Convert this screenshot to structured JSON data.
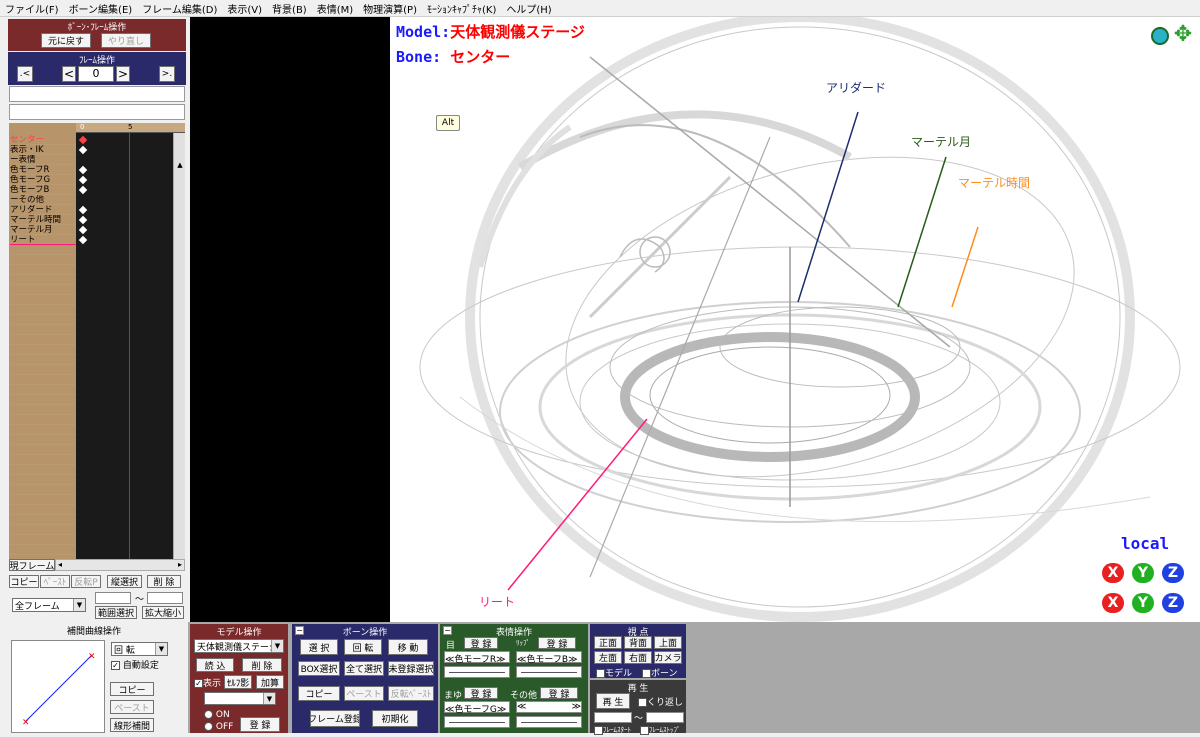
{
  "menu": [
    "ファイル(F)",
    "ボーン編集(E)",
    "フレーム編集(D)",
    "表示(V)",
    "背景(B)",
    "表情(M)",
    "物理演算(P)",
    "ﾓｰｼｮﾝｷｬﾌﾟﾁｬ(K)",
    "ヘルプ(H)"
  ],
  "bone_frame_op": {
    "title": "ﾎﾞｰﾝ･ﾌﾚｰﾑ操作",
    "undo": "元に戻す",
    "redo": "やり直し"
  },
  "frame_op": {
    "title": "ﾌﾚｰﾑ操作",
    "first": ".<",
    "prev": "<",
    "frame": "0",
    "next": ">",
    "last": ">.",
    "first_sym": "|<",
    "last_sym": ">|"
  },
  "timeline": {
    "ruler_0": "0",
    "ruler_5": "5",
    "tracks": [
      "センター",
      "表示・IK",
      "ー表情",
      "色モーフR",
      "色モーフG",
      "色モーフB",
      "ーその他",
      "アリダード",
      "マーテル時間",
      "マーテル月",
      "リート"
    ],
    "current_frame": "現フレーム"
  },
  "frame_edit": {
    "copy": "コピー",
    "paste": "ﾍﾟｰｽﾄ",
    "invert_paste": "反転P",
    "vertical_select": "縦選択",
    "delete": "削 除",
    "range_select_label": "全フレーム",
    "tilde": "～",
    "range_select": "範囲選択",
    "expand_shrink": "拡大縮小"
  },
  "viewport": {
    "model_label": "Model:",
    "model_name": "天体観測儀ステージ",
    "bone_label": "Bone:",
    "bone_name": "センター",
    "alt_badge": "Alt",
    "annotations": {
      "alidade": "アリダード",
      "mater_moon": "マーテル月",
      "mater_time": "マーテル時間",
      "rete": "リート"
    },
    "local": "local",
    "axes_top": [
      "X",
      "Y",
      "Z"
    ],
    "axes_bottom": [
      "X",
      "Y",
      "Z"
    ]
  },
  "interp": {
    "title": "補間曲線操作",
    "mode": "回 転",
    "auto_set": "自動設定",
    "copy": "コピー",
    "paste": "ペースト",
    "linear": "線形補間"
  },
  "model_op": {
    "title": "モデル操作",
    "model_select": "天体観測儀ステージ",
    "load": "読 込",
    "delete": "削 除",
    "display": "表示",
    "self_shadow": "ｾﾙﾌ影",
    "add": "加算",
    "on": "ON",
    "off": "OFF",
    "register": "登 録"
  },
  "bone_op": {
    "title": "ボーン操作",
    "select": "選 択",
    "rotate": "回 転",
    "move": "移 動",
    "box_select": "BOX選択",
    "select_all": "全て選択",
    "unregistered": "未登録選択",
    "copy": "コピー",
    "paste": "ペースト",
    "invert_paste": "反転ﾍﾟｰｽﾄ",
    "frame_register": "フレーム登録",
    "initialize": "初期化"
  },
  "face_op": {
    "title": "表情操作",
    "eye": "目",
    "eye_register": "登 録",
    "lip": "ﾘｯﾌﾟ",
    "lip_register": "登 録",
    "eye_select": "色モーフR",
    "lip_select": "色モーフB",
    "brow": "まゆ",
    "brow_register": "登 録",
    "other": "その他",
    "other_register": "登 録",
    "brow_select": "色モーフG",
    "other_select": ""
  },
  "view": {
    "title": "視 点",
    "front": "正面",
    "back": "背面",
    "top": "上面",
    "left": "左面",
    "right": "右面",
    "camera": "カメラ",
    "model": "モデル",
    "bone": "ボーン"
  },
  "playback": {
    "title": "再 生",
    "play": "再 生",
    "repeat": "くり返し",
    "tilde": "～",
    "frame_start": "ﾌﾚｰﾑｽﾀｰﾄ",
    "frame_stop": "ﾌﾚｰﾑｽﾄｯﾌﾟ"
  },
  "colors": {
    "maroon": "#7a2a2a",
    "navy": "#2a2a6a",
    "green": "#2a5a2a",
    "track_bg": "#b8946a",
    "model_red": "#ff0000",
    "bone_blue": "#0000ff"
  }
}
